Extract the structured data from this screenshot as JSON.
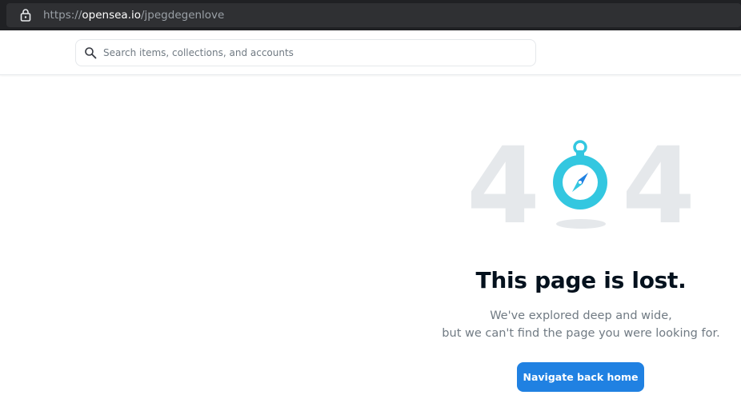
{
  "browser": {
    "url_scheme": "https://",
    "url_host": "opensea.io",
    "url_path": "/jpegdegenlove"
  },
  "header": {
    "search_placeholder": "Search items, collections, and accounts"
  },
  "error": {
    "code_left": "4",
    "code_right": "4",
    "title": "This page is lost.",
    "line1": "We've explored deep and wide,",
    "line2": "but we can't find the page you were looking for.",
    "button_label": "Navigate back home"
  },
  "colors": {
    "accent": "#2081e2",
    "title": "#04111d",
    "muted": "#707a83",
    "digit": "#e5e8eb",
    "compass": "#33c7e0"
  }
}
